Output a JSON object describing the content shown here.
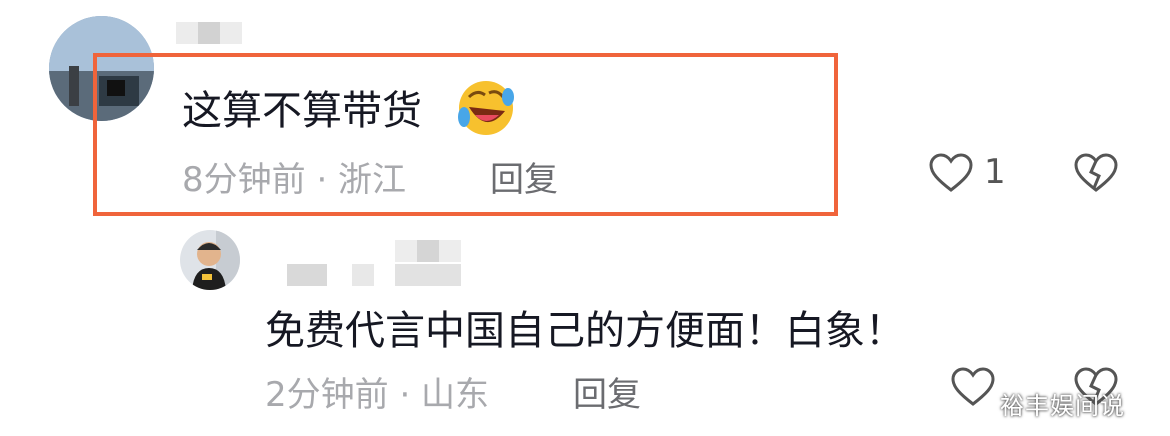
{
  "comment": {
    "text": "这算不算带货",
    "emoji": "rofl-emoji",
    "meta": "8分钟前 · 浙江",
    "reply_label": "回复",
    "like_count": "1"
  },
  "reply": {
    "text": "免费代言中国自己的方便面！白象！",
    "meta": "2分钟前 · 山东",
    "reply_label": "回复"
  },
  "watermark": "裕丰娱间说",
  "colors": {
    "highlight": "#f0643b",
    "text": "#161823",
    "meta": "#a8a9ad"
  }
}
